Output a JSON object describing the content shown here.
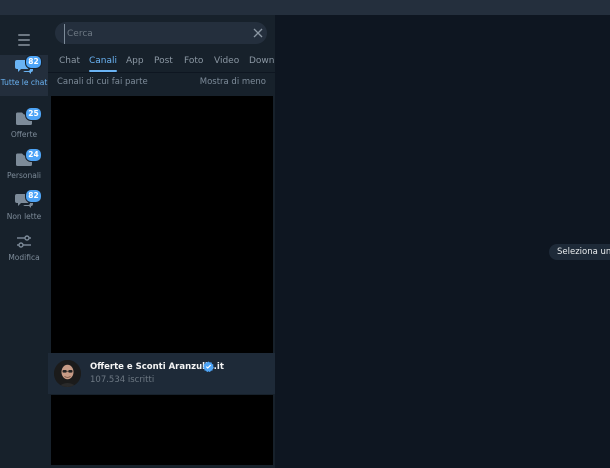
{
  "colors": {
    "accent": "#6ab3f3",
    "badge": "#4ea4f6",
    "sidebar_bg": "#17212b",
    "main_bg": "#0e1621",
    "verified": "#4ea4f6"
  },
  "folders": [
    {
      "name": "chat-bubble-icon",
      "label": "Tutte le chat",
      "badge": "82",
      "active": true
    },
    {
      "name": "folder-icon",
      "label": "Offerte",
      "badge": "25",
      "active": false
    },
    {
      "name": "folder-icon",
      "label": "Personali",
      "badge": "24",
      "active": false
    },
    {
      "name": "chat-bubble-icon",
      "label": "Non lette",
      "badge": "82",
      "active": false
    },
    {
      "name": "sliders-icon",
      "label": "Modifica",
      "badge": "",
      "active": false
    }
  ],
  "search": {
    "placeholder": "Cerca",
    "value": ""
  },
  "tabs": [
    "Chat",
    "Canali",
    "App",
    "Post",
    "Foto",
    "Video",
    "Download"
  ],
  "active_tab": "Canali",
  "section": {
    "title": "Canali di cui fai parte",
    "toggle": "Mostra di meno"
  },
  "channel": {
    "name": "Offerte e Sconti Aranzulla.it",
    "subscribers": "107.534 iscritti",
    "verified_icon": "verified-badge-icon"
  },
  "right_pane": {
    "hint": "Seleziona una"
  }
}
